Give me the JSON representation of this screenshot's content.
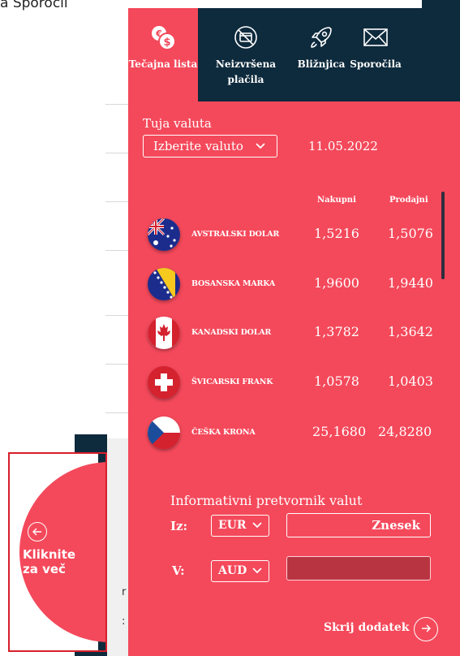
{
  "background": {
    "top_text": "a Sporočil"
  },
  "tabs": [
    {
      "label": "Tečajna lista",
      "icon": "currency-exchange-icon",
      "active": true
    },
    {
      "label": "Neizvršena plačila",
      "icon": "no-card-icon",
      "active": false
    },
    {
      "label": "Bližnjica",
      "icon": "rocket-icon",
      "active": false
    },
    {
      "label": "Sporočila",
      "icon": "envelope-icon",
      "active": false
    }
  ],
  "rates": {
    "foreign_label": "Tuja valuta",
    "select_label": "Izberite valuto",
    "date": "11.05.2022",
    "col_buy": "Nakupni",
    "col_sell": "Prodajni",
    "rows": [
      {
        "name": "AVSTRALSKI DOLAR",
        "buy": "1,5216",
        "sell": "1,5076",
        "flag": "australia-flag-icon"
      },
      {
        "name": "BOSANSKA MARKA",
        "buy": "1,9600",
        "sell": "1,9440",
        "flag": "bosnia-flag-icon"
      },
      {
        "name": "KANADSKI DOLAR",
        "buy": "1,3782",
        "sell": "1,3642",
        "flag": "canada-flag-icon"
      },
      {
        "name": "ŠVICARSKI FRANK",
        "buy": "1,0578",
        "sell": "1,0403",
        "flag": "switzerland-flag-icon"
      },
      {
        "name": "ČEŠKA KRONA",
        "buy": "25,1680",
        "sell": "24,8280",
        "flag": "czech-flag-icon"
      }
    ]
  },
  "converter": {
    "title": "Informativni pretvornik valut",
    "from_label": "Iz:",
    "from_currency": "EUR",
    "amount_placeholder": "Znesek",
    "to_label": "V:",
    "to_currency": "AUD",
    "result": ""
  },
  "hide_label": "Skrij dodatek",
  "hint": {
    "line1": "Kliknite",
    "line2": "za več"
  },
  "colors": {
    "accent": "#f4495b",
    "navy": "#0e2a3d",
    "highlight_border": "#d71f2a"
  }
}
